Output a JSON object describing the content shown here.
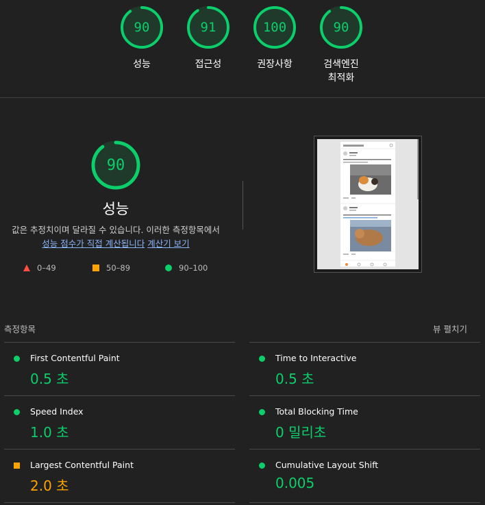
{
  "categories": [
    {
      "score": "90",
      "label": "성능",
      "fraction": 0.9,
      "color": "#0cce6b"
    },
    {
      "score": "91",
      "label": "접근성",
      "fraction": 0.91,
      "color": "#0cce6b"
    },
    {
      "score": "100",
      "label": "권장사항",
      "fraction": 1.0,
      "color": "#0cce6b"
    },
    {
      "score": "90",
      "label": "검색엔진\n최적화",
      "fraction": 0.9,
      "color": "#0cce6b"
    }
  ],
  "performance": {
    "score": "90",
    "fraction": 0.9,
    "title": "성능",
    "desc_prefix": "값은 추정치이며 달라질 수 있습니다. 이러한 측정항목에서",
    "desc_link1": "성능 점수가 직접 계산됩니다",
    "desc_link2": "계산기 보기"
  },
  "legend": [
    {
      "icon": "triangle",
      "label": "0–49",
      "color": "#ff4e42"
    },
    {
      "icon": "square",
      "label": "50–89",
      "color": "#ffa400"
    },
    {
      "icon": "circle",
      "label": "90–100",
      "color": "#0cce6b"
    }
  ],
  "metrics_header": {
    "title": "측정항목",
    "expand": "뷰 펼치기"
  },
  "metrics": [
    {
      "title": "First Contentful Paint",
      "value": "0.5 초",
      "status": "good"
    },
    {
      "title": "Time to Interactive",
      "value": "0.5 초",
      "status": "good"
    },
    {
      "title": "Speed Index",
      "value": "1.0 초",
      "status": "good"
    },
    {
      "title": "Total Blocking Time",
      "value": "0 밀리초",
      "status": "good"
    },
    {
      "title": "Largest Contentful Paint",
      "value": "2.0 초",
      "status": "average"
    },
    {
      "title": "Cumulative Layout Shift",
      "value": "0.005",
      "status": "good"
    }
  ],
  "colors": {
    "good": "#0cce6b",
    "average": "#ffa400",
    "poor": "#ff4e42",
    "background": "#212121"
  }
}
